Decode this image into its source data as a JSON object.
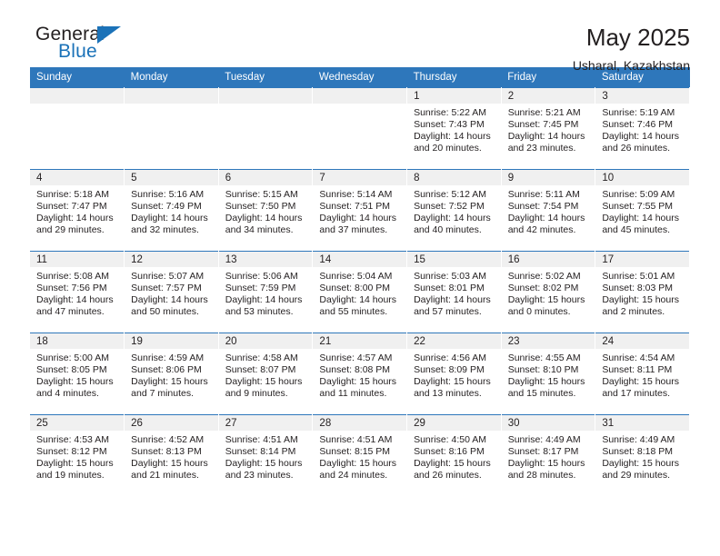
{
  "brand": {
    "name_top": "General",
    "name_bottom": "Blue",
    "accent_color": "#1b72b8"
  },
  "header": {
    "title": "May 2025",
    "location": "Usharal, Kazakhstan"
  },
  "theme": {
    "header_row_color": "#2e77bb",
    "daynum_band_color": "#f0f0f0",
    "text_color": "#231f20"
  },
  "weekday_headers": [
    "Sunday",
    "Monday",
    "Tuesday",
    "Wednesday",
    "Thursday",
    "Friday",
    "Saturday"
  ],
  "labels": {
    "sunrise_prefix": "Sunrise:",
    "sunset_prefix": "Sunset:",
    "daylight_prefix": "Daylight:"
  },
  "weeks": [
    [
      {
        "day": "",
        "sunrise": "",
        "sunset": "",
        "daylight_line1": "",
        "daylight_line2": ""
      },
      {
        "day": "",
        "sunrise": "",
        "sunset": "",
        "daylight_line1": "",
        "daylight_line2": ""
      },
      {
        "day": "",
        "sunrise": "",
        "sunset": "",
        "daylight_line1": "",
        "daylight_line2": ""
      },
      {
        "day": "",
        "sunrise": "",
        "sunset": "",
        "daylight_line1": "",
        "daylight_line2": ""
      },
      {
        "day": "1",
        "sunrise": "Sunrise: 5:22 AM",
        "sunset": "Sunset: 7:43 PM",
        "daylight_line1": "Daylight: 14 hours",
        "daylight_line2": "and 20 minutes."
      },
      {
        "day": "2",
        "sunrise": "Sunrise: 5:21 AM",
        "sunset": "Sunset: 7:45 PM",
        "daylight_line1": "Daylight: 14 hours",
        "daylight_line2": "and 23 minutes."
      },
      {
        "day": "3",
        "sunrise": "Sunrise: 5:19 AM",
        "sunset": "Sunset: 7:46 PM",
        "daylight_line1": "Daylight: 14 hours",
        "daylight_line2": "and 26 minutes."
      }
    ],
    [
      {
        "day": "4",
        "sunrise": "Sunrise: 5:18 AM",
        "sunset": "Sunset: 7:47 PM",
        "daylight_line1": "Daylight: 14 hours",
        "daylight_line2": "and 29 minutes."
      },
      {
        "day": "5",
        "sunrise": "Sunrise: 5:16 AM",
        "sunset": "Sunset: 7:49 PM",
        "daylight_line1": "Daylight: 14 hours",
        "daylight_line2": "and 32 minutes."
      },
      {
        "day": "6",
        "sunrise": "Sunrise: 5:15 AM",
        "sunset": "Sunset: 7:50 PM",
        "daylight_line1": "Daylight: 14 hours",
        "daylight_line2": "and 34 minutes."
      },
      {
        "day": "7",
        "sunrise": "Sunrise: 5:14 AM",
        "sunset": "Sunset: 7:51 PM",
        "daylight_line1": "Daylight: 14 hours",
        "daylight_line2": "and 37 minutes."
      },
      {
        "day": "8",
        "sunrise": "Sunrise: 5:12 AM",
        "sunset": "Sunset: 7:52 PM",
        "daylight_line1": "Daylight: 14 hours",
        "daylight_line2": "and 40 minutes."
      },
      {
        "day": "9",
        "sunrise": "Sunrise: 5:11 AM",
        "sunset": "Sunset: 7:54 PM",
        "daylight_line1": "Daylight: 14 hours",
        "daylight_line2": "and 42 minutes."
      },
      {
        "day": "10",
        "sunrise": "Sunrise: 5:09 AM",
        "sunset": "Sunset: 7:55 PM",
        "daylight_line1": "Daylight: 14 hours",
        "daylight_line2": "and 45 minutes."
      }
    ],
    [
      {
        "day": "11",
        "sunrise": "Sunrise: 5:08 AM",
        "sunset": "Sunset: 7:56 PM",
        "daylight_line1": "Daylight: 14 hours",
        "daylight_line2": "and 47 minutes."
      },
      {
        "day": "12",
        "sunrise": "Sunrise: 5:07 AM",
        "sunset": "Sunset: 7:57 PM",
        "daylight_line1": "Daylight: 14 hours",
        "daylight_line2": "and 50 minutes."
      },
      {
        "day": "13",
        "sunrise": "Sunrise: 5:06 AM",
        "sunset": "Sunset: 7:59 PM",
        "daylight_line1": "Daylight: 14 hours",
        "daylight_line2": "and 53 minutes."
      },
      {
        "day": "14",
        "sunrise": "Sunrise: 5:04 AM",
        "sunset": "Sunset: 8:00 PM",
        "daylight_line1": "Daylight: 14 hours",
        "daylight_line2": "and 55 minutes."
      },
      {
        "day": "15",
        "sunrise": "Sunrise: 5:03 AM",
        "sunset": "Sunset: 8:01 PM",
        "daylight_line1": "Daylight: 14 hours",
        "daylight_line2": "and 57 minutes."
      },
      {
        "day": "16",
        "sunrise": "Sunrise: 5:02 AM",
        "sunset": "Sunset: 8:02 PM",
        "daylight_line1": "Daylight: 15 hours",
        "daylight_line2": "and 0 minutes."
      },
      {
        "day": "17",
        "sunrise": "Sunrise: 5:01 AM",
        "sunset": "Sunset: 8:03 PM",
        "daylight_line1": "Daylight: 15 hours",
        "daylight_line2": "and 2 minutes."
      }
    ],
    [
      {
        "day": "18",
        "sunrise": "Sunrise: 5:00 AM",
        "sunset": "Sunset: 8:05 PM",
        "daylight_line1": "Daylight: 15 hours",
        "daylight_line2": "and 4 minutes."
      },
      {
        "day": "19",
        "sunrise": "Sunrise: 4:59 AM",
        "sunset": "Sunset: 8:06 PM",
        "daylight_line1": "Daylight: 15 hours",
        "daylight_line2": "and 7 minutes."
      },
      {
        "day": "20",
        "sunrise": "Sunrise: 4:58 AM",
        "sunset": "Sunset: 8:07 PM",
        "daylight_line1": "Daylight: 15 hours",
        "daylight_line2": "and 9 minutes."
      },
      {
        "day": "21",
        "sunrise": "Sunrise: 4:57 AM",
        "sunset": "Sunset: 8:08 PM",
        "daylight_line1": "Daylight: 15 hours",
        "daylight_line2": "and 11 minutes."
      },
      {
        "day": "22",
        "sunrise": "Sunrise: 4:56 AM",
        "sunset": "Sunset: 8:09 PM",
        "daylight_line1": "Daylight: 15 hours",
        "daylight_line2": "and 13 minutes."
      },
      {
        "day": "23",
        "sunrise": "Sunrise: 4:55 AM",
        "sunset": "Sunset: 8:10 PM",
        "daylight_line1": "Daylight: 15 hours",
        "daylight_line2": "and 15 minutes."
      },
      {
        "day": "24",
        "sunrise": "Sunrise: 4:54 AM",
        "sunset": "Sunset: 8:11 PM",
        "daylight_line1": "Daylight: 15 hours",
        "daylight_line2": "and 17 minutes."
      }
    ],
    [
      {
        "day": "25",
        "sunrise": "Sunrise: 4:53 AM",
        "sunset": "Sunset: 8:12 PM",
        "daylight_line1": "Daylight: 15 hours",
        "daylight_line2": "and 19 minutes."
      },
      {
        "day": "26",
        "sunrise": "Sunrise: 4:52 AM",
        "sunset": "Sunset: 8:13 PM",
        "daylight_line1": "Daylight: 15 hours",
        "daylight_line2": "and 21 minutes."
      },
      {
        "day": "27",
        "sunrise": "Sunrise: 4:51 AM",
        "sunset": "Sunset: 8:14 PM",
        "daylight_line1": "Daylight: 15 hours",
        "daylight_line2": "and 23 minutes."
      },
      {
        "day": "28",
        "sunrise": "Sunrise: 4:51 AM",
        "sunset": "Sunset: 8:15 PM",
        "daylight_line1": "Daylight: 15 hours",
        "daylight_line2": "and 24 minutes."
      },
      {
        "day": "29",
        "sunrise": "Sunrise: 4:50 AM",
        "sunset": "Sunset: 8:16 PM",
        "daylight_line1": "Daylight: 15 hours",
        "daylight_line2": "and 26 minutes."
      },
      {
        "day": "30",
        "sunrise": "Sunrise: 4:49 AM",
        "sunset": "Sunset: 8:17 PM",
        "daylight_line1": "Daylight: 15 hours",
        "daylight_line2": "and 28 minutes."
      },
      {
        "day": "31",
        "sunrise": "Sunrise: 4:49 AM",
        "sunset": "Sunset: 8:18 PM",
        "daylight_line1": "Daylight: 15 hours",
        "daylight_line2": "and 29 minutes."
      }
    ]
  ]
}
